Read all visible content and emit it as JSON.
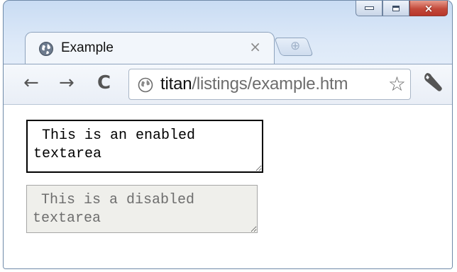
{
  "window": {
    "accent": "#c3493a",
    "controls": {
      "minimize": "minimize-icon",
      "maximize": "maximize-icon",
      "close": "×"
    }
  },
  "tab": {
    "title": "Example",
    "close": "×",
    "favicon": "globe-icon",
    "new_tab_icon": "new-tab-icon"
  },
  "toolbar": {
    "back": "←",
    "forward": "→",
    "reload": "C",
    "url_host": "titan",
    "url_path": "/listings/example.htm",
    "star": "☆",
    "menu_icon": "wrench-icon"
  },
  "page": {
    "enabled_textarea": " This is an enabled\ntextarea",
    "disabled_textarea": " This is a disabled\ntextarea"
  }
}
